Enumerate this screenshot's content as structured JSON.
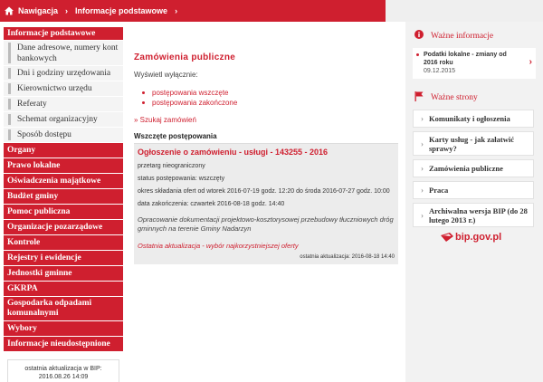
{
  "breadcrumb": {
    "items": [
      "Nawigacja",
      "Informacje podstawowe"
    ]
  },
  "left_nav": {
    "section_title": "Informacje podstawowe",
    "sub_items": [
      "Dane adresowe, numery kont bankowych",
      "Dni i godziny urzędowania",
      "Kierownictwo urzędu",
      "Referaty",
      "Schemat organizacyjny",
      "Sposób dostępu"
    ],
    "items": [
      "Organy",
      "Prawo lokalne",
      "Oświadczenia majątkowe",
      "Budżet gminy",
      "Pomoc publiczna",
      "Organizacje pozarządowe",
      "Kontrole",
      "Rejestry i ewidencje",
      "Jednostki gminne",
      "GKRPA",
      "Gospodarka odpadami komunalnymi",
      "Wybory",
      "Informacje nieudostępnione"
    ],
    "last_update_label": "ostatnia aktualizacja w BIP:",
    "last_update_value": "2016.08.26 14:09"
  },
  "main": {
    "title": "Zamówienia publiczne",
    "show_label": "Wyświetl wyłącznie:",
    "filters": [
      "postępowania wszczęte",
      "postępowania zakończone"
    ],
    "search_link": "» Szukaj zamówień",
    "section_heading": "Wszczęte postępowania",
    "notice": {
      "title": "Ogłoszenie o zamówieniu - usługi - 143255 - 2016",
      "mode": "przetarg nieograniczony",
      "status": "status postępowania: wszczęty",
      "offer_period": "okres składania ofert od wtorek 2016-07-19 godz. 12:20 do środa 2016-07-27 godz. 10:00",
      "end_date": "data zakończenia: czwartek 2016-08-18 godz. 14:40",
      "description": "Opracowanie dokumentacji projektowo-kosztorysowej przebudowy tłuczniowych dróg gminnych na terenie Gminy Nadarzyn",
      "latest_update": "Ostatnia aktualizacja - wybór najkorzystniejszej oferty",
      "updated": "ostatnia aktualizacja: 2016-08-18 14:40"
    }
  },
  "right": {
    "important_info_title": "Ważne informacje",
    "news": {
      "title": "Podatki lokalne - zmiany od 2016 roku",
      "date": "09.12.2015"
    },
    "important_pages_title": "Ważne strony",
    "links": [
      "Komunikaty i ogłoszenia",
      "Karty usług - jak załatwić sprawy?",
      "Zamówienia publiczne",
      "Praca",
      "Archiwalna wersja BIP (do 28 lutego 2013 r.)"
    ],
    "bip_logo_text": "bip.gov.pl"
  },
  "colors": {
    "accent": "#cf1f2f",
    "panel": "#f2f2f2"
  }
}
